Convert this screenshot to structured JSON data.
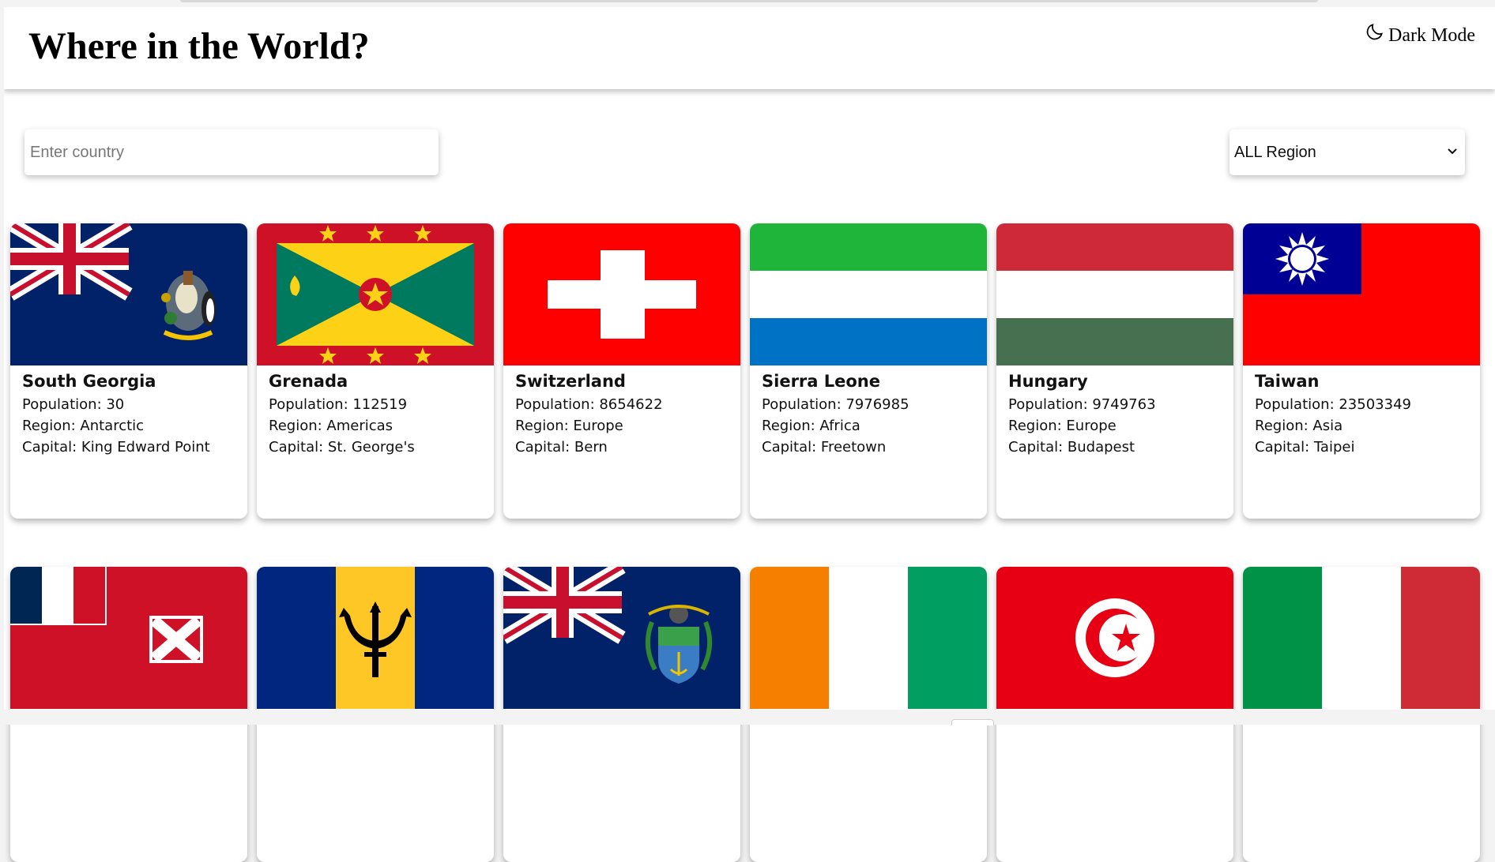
{
  "header": {
    "title": "Where in the World?",
    "dark_mode_label": "Dark Mode",
    "dark_mode_icon": "moon-icon"
  },
  "search": {
    "placeholder": "Enter country",
    "value": ""
  },
  "region_filter": {
    "selected": "ALL Region",
    "icon": "chevron-down-icon"
  },
  "labels": {
    "population": "Population: ",
    "region": "Region: ",
    "capital": "Capital: "
  },
  "countries": [
    {
      "name": "South Georgia",
      "population": "30",
      "region": "Antarctic",
      "capital": "King Edward Point",
      "flag": "south-georgia-flag"
    },
    {
      "name": "Grenada",
      "population": "112519",
      "region": "Americas",
      "capital": "St. George's",
      "flag": "grenada-flag"
    },
    {
      "name": "Switzerland",
      "population": "8654622",
      "region": "Europe",
      "capital": "Bern",
      "flag": "switzerland-flag"
    },
    {
      "name": "Sierra Leone",
      "population": "7976985",
      "region": "Africa",
      "capital": "Freetown",
      "flag": "sierra-leone-flag"
    },
    {
      "name": "Hungary",
      "population": "9749763",
      "region": "Europe",
      "capital": "Budapest",
      "flag": "hungary-flag"
    },
    {
      "name": "Taiwan",
      "population": "23503349",
      "region": "Asia",
      "capital": "Taipei",
      "flag": "taiwan-flag"
    },
    {
      "flag": "wallis-and-futuna-flag"
    },
    {
      "flag": "barbados-flag"
    },
    {
      "flag": "pitcairn-islands-flag"
    },
    {
      "flag": "ivory-coast-flag"
    },
    {
      "flag": "tunisia-flag"
    },
    {
      "flag": "italy-flag"
    }
  ],
  "colors": {
    "navy": "#012169",
    "red": "#ff0000",
    "green": "#1eb53a",
    "blue": "#0072c6",
    "hungary_red": "#ce2939",
    "hungary_green": "#477050",
    "grenada_red": "#ce1126",
    "grenada_yellow": "#fcd116",
    "grenada_green": "#007a5e",
    "taiwan_blue": "#000095",
    "barbados_blue": "#00267f",
    "barbados_gold": "#ffc726",
    "ivory_orange": "#f77f00",
    "ivory_green": "#009e60",
    "tunisia_red": "#e70013",
    "italy_green": "#009246",
    "italy_red": "#ce2b37"
  }
}
